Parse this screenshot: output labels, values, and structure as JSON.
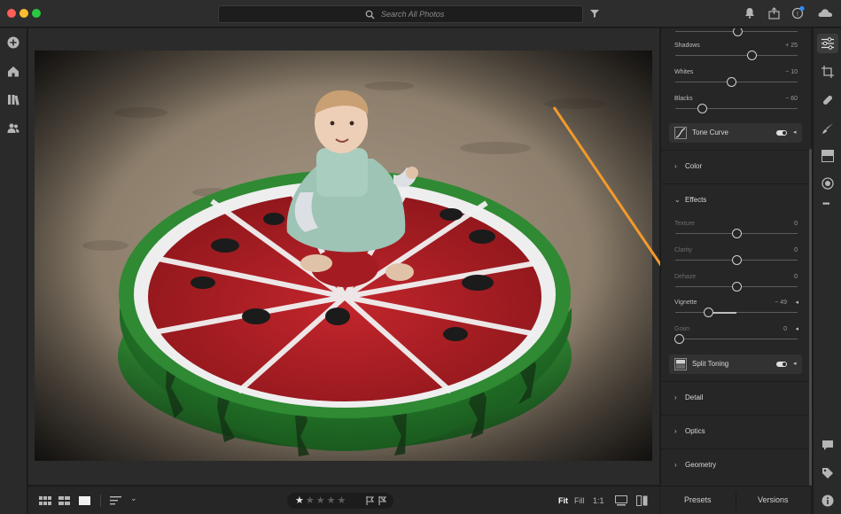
{
  "search": {
    "placeholder": "Search All Photos"
  },
  "panel": {
    "top_sliders": [
      {
        "label": "",
        "value": "",
        "position": 0.5
      },
      {
        "label": "Shadows",
        "value": "+ 25",
        "position": 0.62
      },
      {
        "label": "Whites",
        "value": "− 10",
        "position": 0.46
      },
      {
        "label": "Blacks",
        "value": "− 60",
        "position": 0.21
      }
    ],
    "tone_curve": {
      "label": "Tone Curve"
    },
    "color": {
      "label": "Color"
    },
    "effects": {
      "label": "Effects",
      "sliders": [
        {
          "label": "Texture",
          "value": "0",
          "position": 0.5,
          "dim": true
        },
        {
          "label": "Clarity",
          "value": "0",
          "position": 0.5,
          "dim": true
        },
        {
          "label": "Dehaze",
          "value": "0",
          "position": 0.5,
          "dim": true
        },
        {
          "label": "Vignette",
          "value": "− 49",
          "position": 0.26,
          "dim": false
        },
        {
          "label": "Grain",
          "value": "0",
          "position": 0.0,
          "dim": true
        }
      ]
    },
    "split_toning": {
      "label": "Split Toning"
    },
    "detail": {
      "label": "Detail"
    },
    "optics": {
      "label": "Optics"
    },
    "geometry": {
      "label": "Geometry"
    }
  },
  "panel_bottom": {
    "presets": "Presets",
    "versions": "Versions"
  },
  "view": {
    "fit": "Fit",
    "fill": "Fill",
    "one_to_one": "1:1"
  },
  "rating": {
    "stars": "★★★★★",
    "filled": 1
  },
  "icons": {
    "traffic": [
      "#ff5f57",
      "#febc2e",
      "#28c840"
    ],
    "arrow_color": "#f39a2c"
  }
}
